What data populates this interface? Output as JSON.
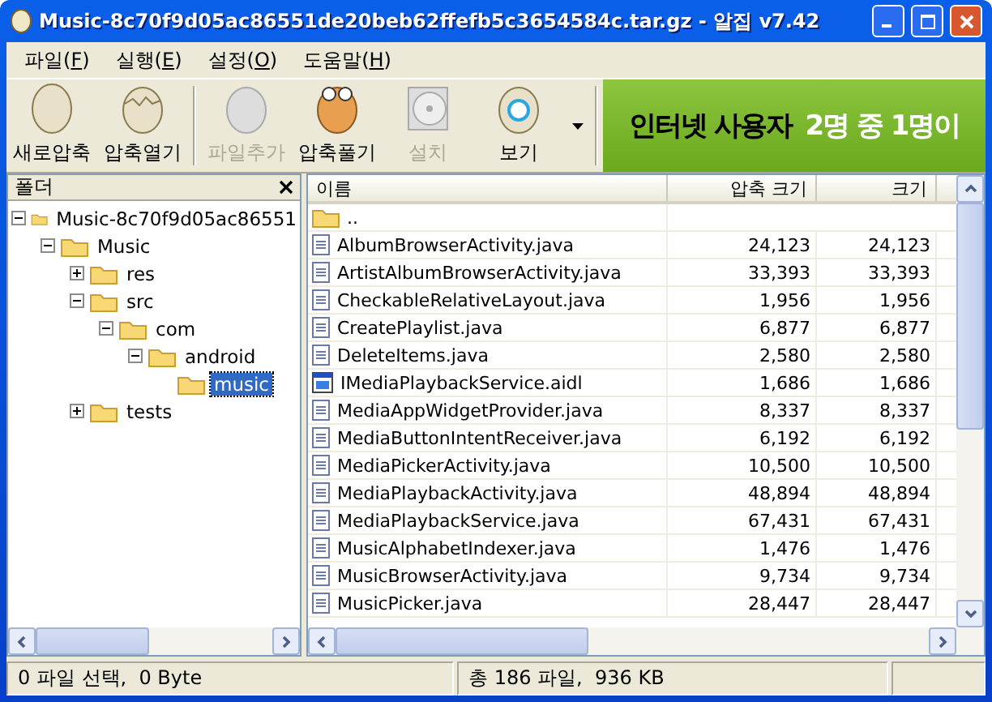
{
  "window": {
    "title": "Music-8c70f9d05ac86551de20beb62ffefb5c3654584c.tar.gz - 알집 v7.42"
  },
  "menu": [
    {
      "label": "파일(",
      "key": "F",
      "end": ")"
    },
    {
      "label": "실행(",
      "key": "E",
      "end": ")"
    },
    {
      "label": "설정(",
      "key": "O",
      "end": ")"
    },
    {
      "label": "도움말(",
      "key": "H",
      "end": ")"
    }
  ],
  "toolbar": [
    {
      "kind": "egg",
      "label": "새로압축",
      "disabled": false
    },
    {
      "kind": "cracked",
      "label": "압축열기",
      "disabled": false
    },
    {
      "kind": "add",
      "label": "파일추가",
      "disabled": true
    },
    {
      "kind": "extract",
      "label": "압축풀기",
      "disabled": false
    },
    {
      "kind": "disc",
      "label": "설치",
      "disabled": true
    },
    {
      "kind": "view",
      "label": "보기",
      "disabled": false
    }
  ],
  "banner": {
    "text": "인터넷 사용자",
    "highlight": "2명 중 1명이"
  },
  "folder_pane": {
    "title": "폴더",
    "tree": [
      {
        "label": "Music-8c70f9d05ac86551",
        "expanded": true,
        "selected": false,
        "children": [
          {
            "label": "Music",
            "expanded": true,
            "selected": false,
            "children": [
              {
                "label": "res",
                "expanded": false,
                "selected": false
              },
              {
                "label": "src",
                "expanded": true,
                "selected": false,
                "children": [
                  {
                    "label": "com",
                    "expanded": true,
                    "selected": false,
                    "children": [
                      {
                        "label": "android",
                        "expanded": true,
                        "selected": false,
                        "children": [
                          {
                            "label": "music",
                            "selected": true
                          }
                        ]
                      }
                    ]
                  }
                ]
              },
              {
                "label": "tests",
                "expanded": false,
                "selected": false
              }
            ]
          }
        ]
      }
    ]
  },
  "table": {
    "columns": [
      "이름",
      "압축 크기",
      "크기"
    ],
    "rows": [
      {
        "kind": "folder",
        "name": "..",
        "packed": "",
        "size": ""
      },
      {
        "kind": "java",
        "name": "AlbumBrowserActivity.java",
        "packed": "24,123",
        "size": "24,123"
      },
      {
        "kind": "java",
        "name": "ArtistAlbumBrowserActivity.java",
        "packed": "33,393",
        "size": "33,393"
      },
      {
        "kind": "java",
        "name": "CheckableRelativeLayout.java",
        "packed": "1,956",
        "size": "1,956"
      },
      {
        "kind": "java",
        "name": "CreatePlaylist.java",
        "packed": "6,877",
        "size": "6,877"
      },
      {
        "kind": "java",
        "name": "DeleteItems.java",
        "packed": "2,580",
        "size": "2,580"
      },
      {
        "kind": "aidl",
        "name": "IMediaPlaybackService.aidl",
        "packed": "1,686",
        "size": "1,686"
      },
      {
        "kind": "java",
        "name": "MediaAppWidgetProvider.java",
        "packed": "8,337",
        "size": "8,337"
      },
      {
        "kind": "java",
        "name": "MediaButtonIntentReceiver.java",
        "packed": "6,192",
        "size": "6,192"
      },
      {
        "kind": "java",
        "name": "MediaPickerActivity.java",
        "packed": "10,500",
        "size": "10,500"
      },
      {
        "kind": "java",
        "name": "MediaPlaybackActivity.java",
        "packed": "48,894",
        "size": "48,894"
      },
      {
        "kind": "java",
        "name": "MediaPlaybackService.java",
        "packed": "67,431",
        "size": "67,431"
      },
      {
        "kind": "java",
        "name": "MusicAlphabetIndexer.java",
        "packed": "1,476",
        "size": "1,476"
      },
      {
        "kind": "java",
        "name": "MusicBrowserActivity.java",
        "packed": "9,734",
        "size": "9,734"
      },
      {
        "kind": "java",
        "name": "MusicPicker.java",
        "packed": "28,447",
        "size": "28,447"
      }
    ]
  },
  "status_bar": [
    "0 파일 선택,  0 Byte",
    "총 186 파일,  936 KB"
  ]
}
